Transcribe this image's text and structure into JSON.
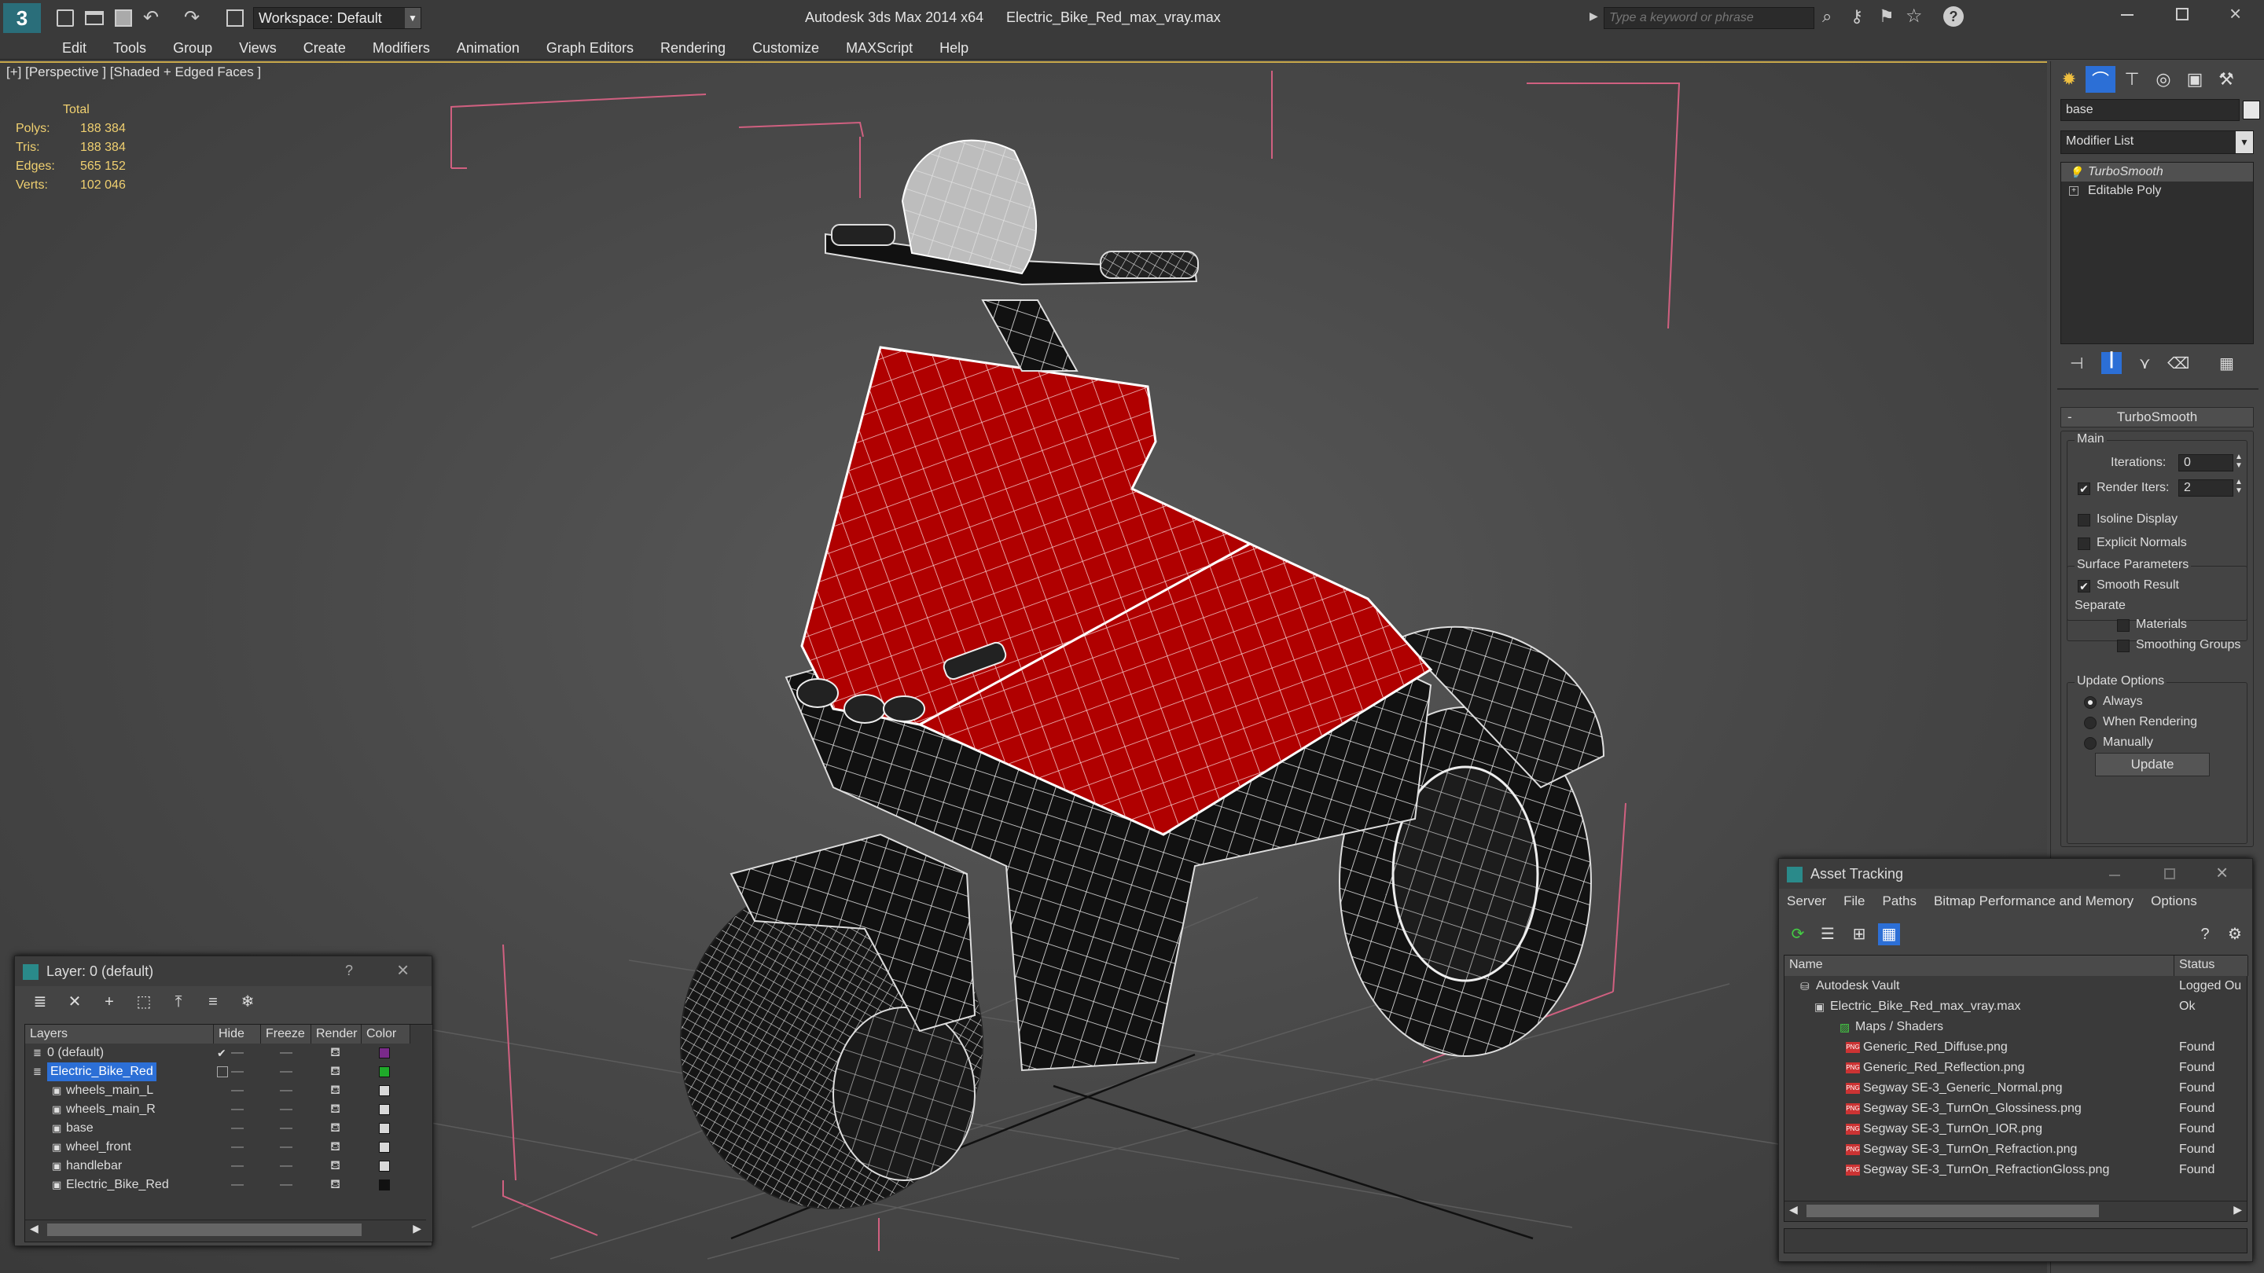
{
  "titlebar": {
    "app_title": "Autodesk 3ds Max 2014 x64",
    "file_name": "Electric_Bike_Red_max_vray.max",
    "workspace_label": "Workspace: Default",
    "search_placeholder": "Type a keyword or phrase"
  },
  "menu": [
    "Edit",
    "Tools",
    "Group",
    "Views",
    "Create",
    "Modifiers",
    "Animation",
    "Graph Editors",
    "Rendering",
    "Customize",
    "MAXScript",
    "Help"
  ],
  "viewport": {
    "label": "[+] [Perspective ] [Shaded + Edged Faces ]",
    "stats": {
      "header": "Total",
      "polys_label": "Polys:",
      "polys": "188 384",
      "tris_label": "Tris:",
      "tris": "188 384",
      "edges_label": "Edges:",
      "edges": "565 152",
      "verts_label": "Verts:",
      "verts": "102 046"
    }
  },
  "command_panel": {
    "object_name": "base",
    "modifier_list": "Modifier List",
    "stack": [
      "TurboSmooth",
      "Editable Poly"
    ],
    "rollout_title": "TurboSmooth",
    "main_label": "Main",
    "iterations_label": "Iterations:",
    "iterations": "0",
    "render_iters_label": "Render Iters:",
    "render_iters": "2",
    "isoline_label": "Isoline Display",
    "explicit_label": "Explicit Normals",
    "surface_label": "Surface Parameters",
    "smooth_label": "Smooth Result",
    "separate_label": "Separate",
    "materials_label": "Materials",
    "smoothing_label": "Smoothing Groups",
    "update_options_label": "Update Options",
    "always_label": "Always",
    "when_rendering_label": "When Rendering",
    "manually_label": "Manually",
    "update_button": "Update"
  },
  "layer_window": {
    "title": "Layer: 0 (default)",
    "help": "?",
    "columns": [
      "Layers",
      "Hide",
      "Freeze",
      "Render",
      "Color"
    ],
    "rows": [
      {
        "name": "0 (default)",
        "color": "#7a2a8a"
      },
      {
        "name": "Electric_Bike_Red",
        "color": "#1faa2a"
      },
      {
        "name": "wheels_main_L",
        "color": "#d8d8d8"
      },
      {
        "name": "wheels_main_R",
        "color": "#d8d8d8"
      },
      {
        "name": "base",
        "color": "#d8d8d8"
      },
      {
        "name": "wheel_front",
        "color": "#d8d8d8"
      },
      {
        "name": "handlebar",
        "color": "#d8d8d8"
      },
      {
        "name": "Electric_Bike_Red",
        "color": "#111111"
      }
    ]
  },
  "asset_window": {
    "title": "Asset Tracking",
    "menu": [
      "Server",
      "File",
      "Paths",
      "Bitmap Performance and Memory",
      "Options"
    ],
    "columns": [
      "Name",
      "Status"
    ],
    "rows": [
      {
        "name": "Autodesk Vault",
        "status": "Logged Ou"
      },
      {
        "name": "Electric_Bike_Red_max_vray.max",
        "status": "Ok"
      },
      {
        "name": "Maps / Shaders",
        "status": ""
      },
      {
        "name": "Generic_Red_Diffuse.png",
        "status": "Found"
      },
      {
        "name": "Generic_Red_Reflection.png",
        "status": "Found"
      },
      {
        "name": "Segway SE-3_Generic_Normal.png",
        "status": "Found"
      },
      {
        "name": "Segway SE-3_TurnOn_Glossiness.png",
        "status": "Found"
      },
      {
        "name": "Segway SE-3_TurnOn_IOR.png",
        "status": "Found"
      },
      {
        "name": "Segway SE-3_TurnOn_Refraction.png",
        "status": "Found"
      },
      {
        "name": "Segway SE-3_TurnOn_RefractionGloss.png",
        "status": "Found"
      }
    ]
  },
  "colors": {
    "selection_blue": "#2c6fd6",
    "stats_yellow": "#f0d070",
    "body_red": "#b00000",
    "bbox_pink": "#d06080"
  }
}
